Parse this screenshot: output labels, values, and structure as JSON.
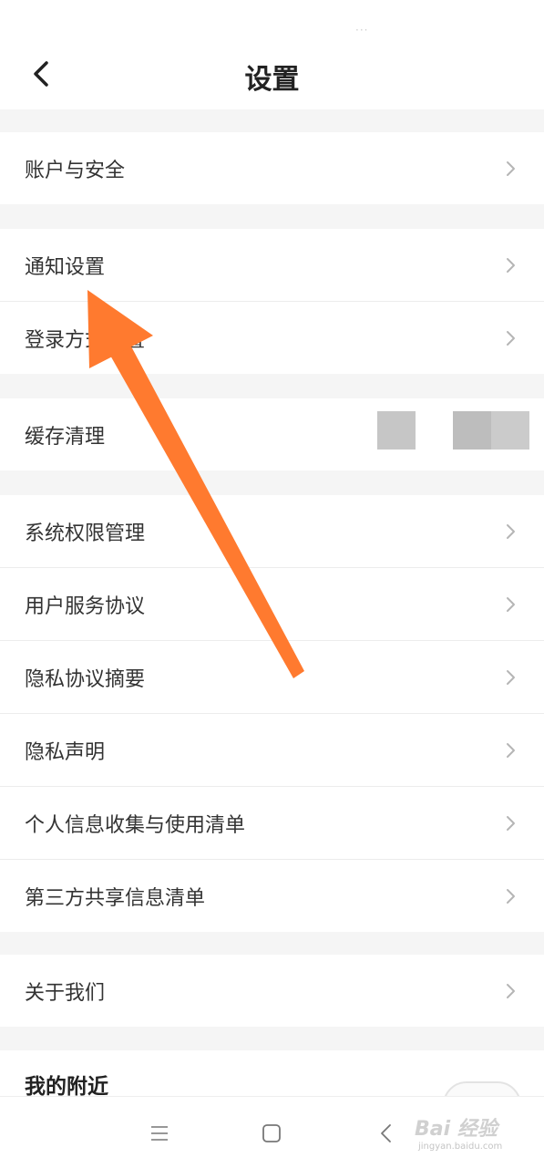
{
  "header": {
    "title": "设置",
    "status_dots": "···"
  },
  "groups": [
    {
      "items": [
        {
          "label": "账户与安全"
        }
      ]
    },
    {
      "items": [
        {
          "label": "通知设置"
        },
        {
          "label": "登录方式设置"
        }
      ]
    },
    {
      "items": [
        {
          "label": "缓存清理"
        }
      ]
    },
    {
      "items": [
        {
          "label": "系统权限管理"
        },
        {
          "label": "用户服务协议"
        },
        {
          "label": "隐私协议摘要"
        },
        {
          "label": "隐私声明"
        },
        {
          "label": "个人信息收集与使用清单"
        },
        {
          "label": "第三方共享信息清单"
        }
      ]
    },
    {
      "items": [
        {
          "label": "关于我们"
        }
      ]
    }
  ],
  "nearby": {
    "label": "我的附近"
  },
  "navbar": {
    "menu_icon": "menu-icon",
    "home_icon": "square-home-icon",
    "back_icon": "triangle-back-icon"
  },
  "watermark": {
    "main": "Bai 经验",
    "sub": "jingyan.baidu.com"
  },
  "colors": {
    "background": "#f5f5f5",
    "surface": "#ffffff",
    "text": "#333333",
    "arrow": "#ff7a2f"
  }
}
